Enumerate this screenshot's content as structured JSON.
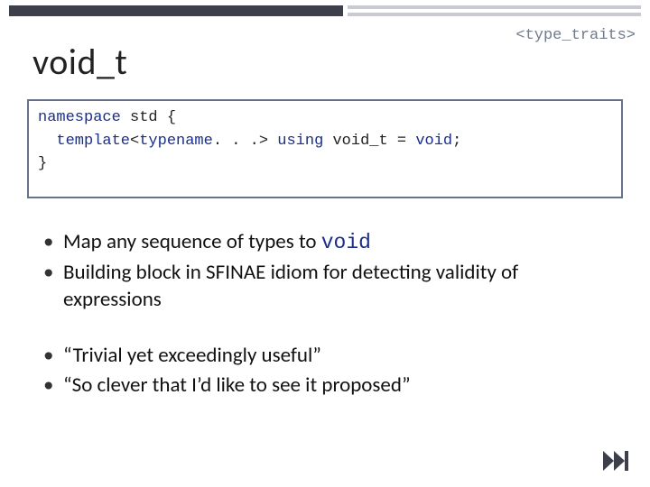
{
  "header": {
    "include": "<type_traits>"
  },
  "title": "void_t",
  "code": {
    "line1_kw1": "namespace",
    "line1_rest": " std {",
    "line2_kw1": "template",
    "line2_mid": "<",
    "line2_kw2": "typename",
    "line2_mid2": ". . .> ",
    "line2_kw3": "using",
    "line2_mid3": " void_t = ",
    "line2_kw4": "void",
    "line2_end": ";",
    "line3": "}"
  },
  "bullets": {
    "b1_pre": "Map any sequence of types to ",
    "b1_mono": "void",
    "b2": "Building block in SFINAE idiom for detecting validity of expressions",
    "b3": "“Trivial yet exceedingly useful”",
    "b4": "“So clever that I’d like to see it proposed”"
  },
  "nav": {
    "next_icon": "fast-forward"
  }
}
